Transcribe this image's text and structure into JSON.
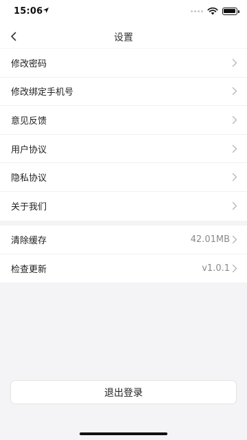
{
  "status_bar": {
    "time": "15:06"
  },
  "nav": {
    "title": "设置"
  },
  "settings_group_1": [
    {
      "label": "修改密码"
    },
    {
      "label": "修改绑定手机号"
    },
    {
      "label": "意见反馈"
    },
    {
      "label": "用户协议"
    },
    {
      "label": "隐私协议"
    },
    {
      "label": "关于我们"
    }
  ],
  "settings_group_2": [
    {
      "label": "清除缓存",
      "value": "42.01MB"
    },
    {
      "label": "检查更新",
      "value": "v1.0.1"
    }
  ],
  "logout": {
    "label": "退出登录"
  },
  "icons": {
    "back": "chevron-left-icon",
    "row": "chevron-right-icon",
    "location": "location-arrow-icon",
    "wifi": "wifi-icon",
    "battery": "battery-icon"
  }
}
